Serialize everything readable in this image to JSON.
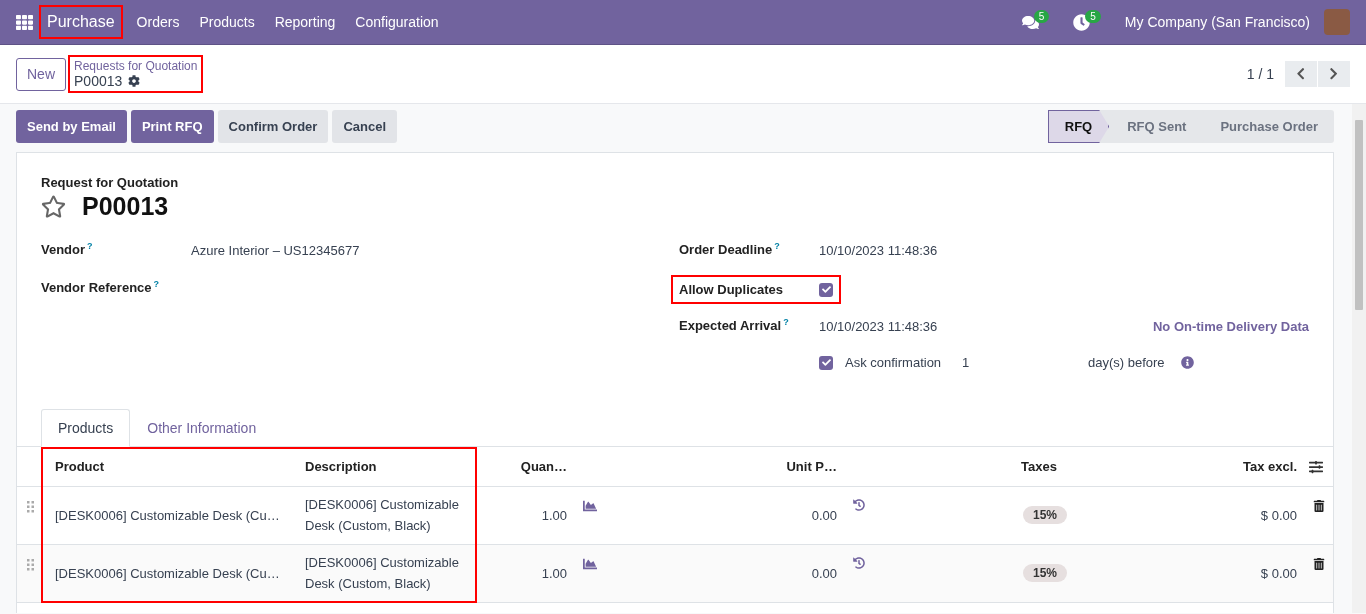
{
  "navbar": {
    "app": {
      "label": "Purchase",
      "highlighted": true
    },
    "menu": [
      "Orders",
      "Products",
      "Reporting",
      "Configuration"
    ],
    "messages_count": "5",
    "activities_count": "5",
    "company": "My Company (San Francisco)"
  },
  "control_panel": {
    "new_button": "New",
    "breadcrumb": {
      "parent": "Requests for Quotation",
      "current": "P00013",
      "highlighted": true
    },
    "pager": "1 / 1"
  },
  "actions": [
    {
      "label": "Send by Email",
      "kind": "primary"
    },
    {
      "label": "Print RFQ",
      "kind": "primary"
    },
    {
      "label": "Confirm Order",
      "kind": "secondary"
    },
    {
      "label": "Cancel",
      "kind": "secondary"
    }
  ],
  "status_steps": [
    {
      "label": "RFQ",
      "selected": true
    },
    {
      "label": "RFQ Sent",
      "selected": false
    },
    {
      "label": "Purchase Order",
      "selected": false
    }
  ],
  "form": {
    "subtitle": "Request for Quotation",
    "title": "P00013",
    "starred": false,
    "left_fields": [
      {
        "label": "Vendor",
        "help": "?",
        "value": "Azure Interior – US12345677"
      },
      {
        "label": "Vendor Reference",
        "help": "?"
      }
    ],
    "right_fields": [
      {
        "label": "Order Deadline",
        "help": "?",
        "kind": "text",
        "value": "10/10/2023 11:48:36"
      },
      {
        "label": "Allow Duplicates",
        "kind": "checkbox",
        "checked": true,
        "highlighted": true
      },
      {
        "label": "Expected Arrival",
        "help": "?",
        "kind": "text",
        "value": "10/10/2023 11:48:36",
        "link": "No On-time Delivery Data"
      }
    ],
    "ask_confirmation": {
      "checked": true,
      "label": "Ask confirmation",
      "days": "1",
      "suffix": "day(s) before"
    }
  },
  "tabs": [
    {
      "label": "Products",
      "selected": true
    },
    {
      "label": "Other Information",
      "selected": false
    }
  ],
  "table": {
    "highlighted": true,
    "columns": [
      {
        "label": "Product"
      },
      {
        "label": "Description"
      },
      {
        "label": "Quan…"
      },
      {
        "label": "Unit P…"
      },
      {
        "label": "Taxes"
      },
      {
        "label": "Tax excl."
      }
    ],
    "rows": [
      {
        "product": "[DESK0006] Customizable Desk (Cu…",
        "description": "[DESK0006] Customizable Desk (Custom, Black)",
        "quantity": "1.00",
        "unit_price": "0.00",
        "tax": "15%",
        "subtotal": "$ 0.00"
      },
      {
        "product": "[DESK0006] Customizable Desk (Cu…",
        "description": "[DESK0006] Customizable Desk (Custom, Black)",
        "quantity": "1.00",
        "unit_price": "0.00",
        "tax": "15%",
        "subtotal": "$ 0.00"
      }
    ]
  }
}
